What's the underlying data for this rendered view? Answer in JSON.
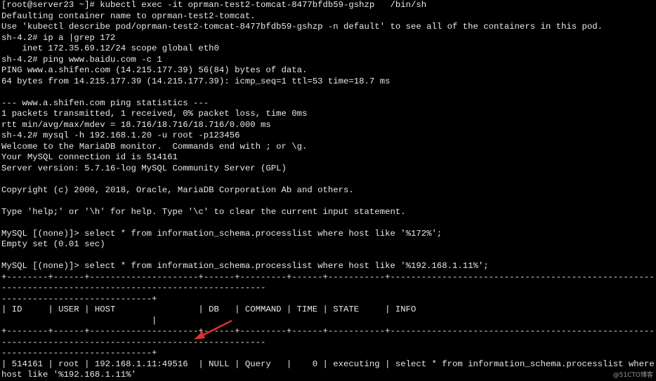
{
  "terminal": {
    "lines": [
      "[root@server23 ~]# kubectl exec -it oprman-test2-tomcat-8477bfdb59-gshzp   /bin/sh",
      "Defaulting container name to oprman-test2-tomcat.",
      "Use 'kubectl describe pod/oprman-test2-tomcat-8477bfdb59-gshzp -n default' to see all of the containers in this pod.",
      "sh-4.2# ip a |grep 172",
      "    inet 172.35.69.12/24 scope global eth0",
      "sh-4.2# ping www.baidu.com -c 1",
      "PING www.a.shifen.com (14.215.177.39) 56(84) bytes of data.",
      "64 bytes from 14.215.177.39 (14.215.177.39): icmp_seq=1 ttl=53 time=18.7 ms",
      "",
      "--- www.a.shifen.com ping statistics ---",
      "1 packets transmitted, 1 received, 0% packet loss, time 0ms",
      "rtt min/avg/max/mdev = 18.716/18.716/18.716/0.000 ms",
      "sh-4.2# mysql -h 192.168.1.20 -u root -p123456",
      "Welcome to the MariaDB monitor.  Commands end with ; or \\g.",
      "Your MySQL connection id is 514161",
      "Server version: 5.7.16-log MySQL Community Server (GPL)",
      "",
      "Copyright (c) 2000, 2018, Oracle, MariaDB Corporation Ab and others.",
      "",
      "Type 'help;' or '\\h' for help. Type '\\c' to clear the current input statement.",
      "",
      "MySQL [(none)]> select * from information_schema.processlist where host like '%172%';",
      "Empty set (0.01 sec)",
      "",
      "MySQL [(none)]> select * from information_schema.processlist where host like '%192.168.1.11%';",
      "+--------+------+---------------------+------+---------+------+-----------+------------------------------------------------------------------------------------------------------",
      "-----------------------------+",
      "| ID     | USER | HOST                | DB   | COMMAND | TIME | STATE     | INFO",
      "                             |",
      "+--------+------+---------------------+------+---------+------+-----------+------------------------------------------------------------------------------------------------------",
      "-----------------------------+",
      "| 514161 | root | 192.168.1.11:49516  | NULL | Query   |    0 | executing | select * from information_schema.processlist where host like '%192.168.1.11%'"
    ]
  },
  "watermark": "@51CTO博客",
  "colors": {
    "background": "#000000",
    "text": "#e8e8e8",
    "arrow": "#e0302a"
  }
}
